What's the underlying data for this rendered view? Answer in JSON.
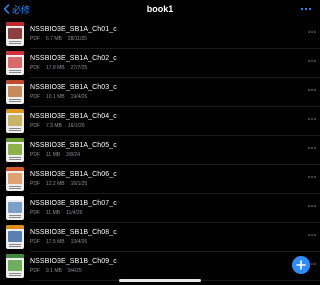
{
  "header": {
    "back_label": "必修",
    "title": "book1",
    "back_icon": "chevron-left-icon",
    "more_icon": "ellipsis-icon"
  },
  "colors": {
    "accent": "#2f8cff",
    "background": "#000000",
    "secondary_text": "#8e8e93"
  },
  "files": [
    {
      "name": "NSSBIO3E_SB1A_Ch01_c",
      "type": "PDF",
      "size": "6.7 MB",
      "date": "28/11/25",
      "thumb_color": "#c0282d",
      "img_color": "#8d3f3f"
    },
    {
      "name": "NSSBIO3E_SB1A_Ch02_c",
      "type": "PDF",
      "size": "17.8 MB",
      "date": "27/7/25",
      "thumb_color": "#d0323c",
      "img_color": "#d96a6a"
    },
    {
      "name": "NSSBIO3E_SB1A_Ch03_c",
      "type": "PDF",
      "size": "10.1 MB",
      "date": "19/4/26",
      "thumb_color": "#c24b2e",
      "img_color": "#c78a5a"
    },
    {
      "name": "NSSBIO3E_SB1A_Ch04_c",
      "type": "PDF",
      "size": "7.3 MB",
      "date": "16/1/26",
      "thumb_color": "#e09a1f",
      "img_color": "#c9b36a"
    },
    {
      "name": "NSSBIO3E_SB1A_Ch05_c",
      "type": "PDF",
      "size": "11 MB",
      "date": "2/8/24",
      "thumb_color": "#6a9a2a",
      "img_color": "#8fb34a"
    },
    {
      "name": "NSSBIO3E_SB1A_Ch06_c",
      "type": "PDF",
      "size": "12.2 MB",
      "date": "16/1/25",
      "thumb_color": "#d35a2a",
      "img_color": "#e0a070"
    },
    {
      "name": "NSSBIO3E_SB1B_Ch07_c",
      "type": "PDF",
      "size": "11 MB",
      "date": "11/4/26",
      "thumb_color": "#ffffff",
      "img_color": "#7aa0c8"
    },
    {
      "name": "NSSBIO3E_SB1B_Ch08_c",
      "type": "PDF",
      "size": "17.5 MB",
      "date": "13/4/26",
      "thumb_color": "#e08a1a",
      "img_color": "#5a7fb0"
    },
    {
      "name": "NSSBIO3E_SB1B_Ch09_c",
      "type": "PDF",
      "size": "9.1 MB",
      "date": "9/4/25",
      "thumb_color": "#3f8a3a",
      "img_color": "#6fae5f"
    }
  ],
  "fab": {
    "icon": "plus-icon"
  }
}
